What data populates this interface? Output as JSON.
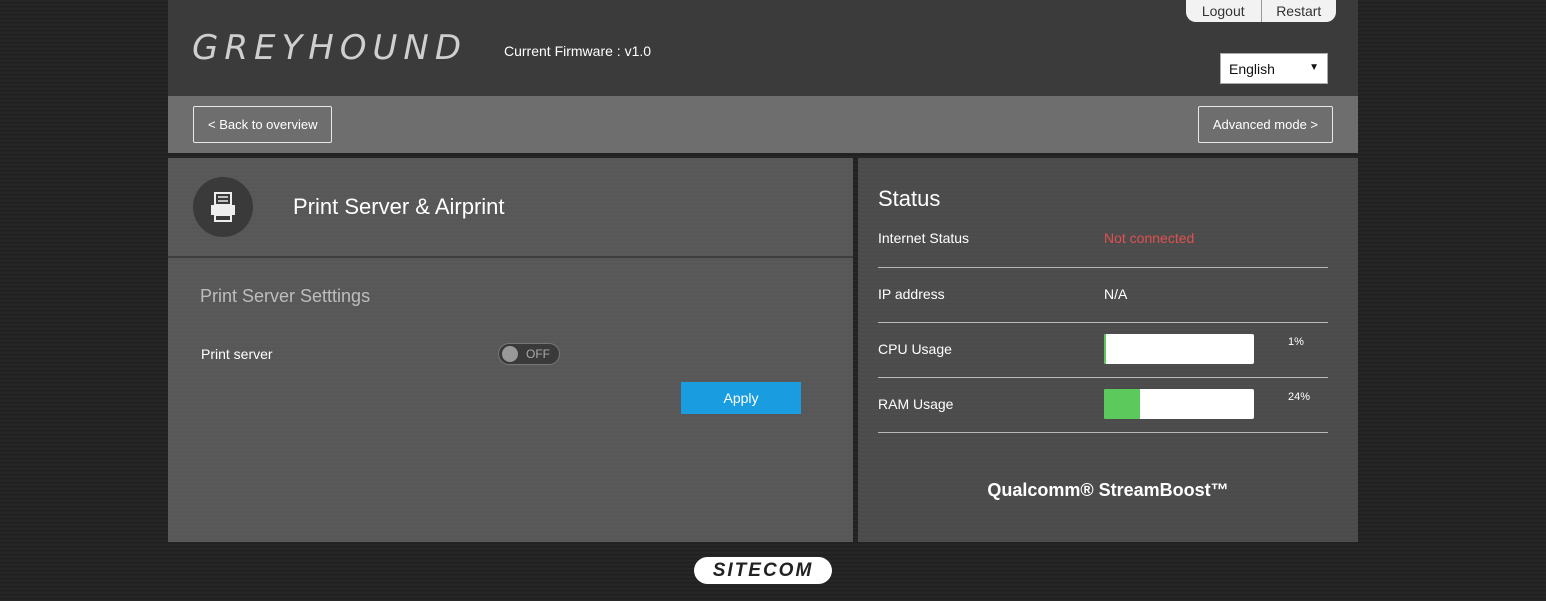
{
  "header": {
    "logo": "GREYHOUND",
    "firmware": "Current Firmware : v1.0",
    "logout_label": "Logout",
    "restart_label": "Restart",
    "language": "English"
  },
  "nav": {
    "back_label": "< Back to overview",
    "advanced_label": "Advanced mode >"
  },
  "panel": {
    "title": "Print Server & Airprint",
    "icon": "printer-icon",
    "section_title": "Print Server Setttings",
    "print_server_label": "Print server",
    "toggle_state": "OFF",
    "apply_label": "Apply"
  },
  "status": {
    "title": "Status",
    "internet_label": "Internet Status",
    "internet_value": "Not connected",
    "internet_color": "#e05050",
    "ip_label": "IP address",
    "ip_value": "N/A",
    "cpu_label": "CPU Usage",
    "cpu_value": "1%",
    "cpu_fraction": 0.01,
    "ram_label": "RAM Usage",
    "ram_value": "24%",
    "ram_fraction": 0.24,
    "brand": "Qualcomm® StreamBoost™"
  },
  "footer": {
    "brand": "SITECOM"
  }
}
